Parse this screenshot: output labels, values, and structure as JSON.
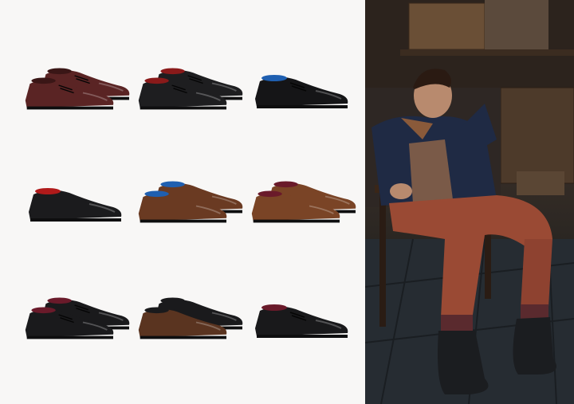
{
  "catalog": {
    "shoes": [
      {
        "id": "oxford-brogue-burgundy",
        "color": "#5a2424",
        "accent": "#3a1616",
        "style": "brogue"
      },
      {
        "id": "oxford-brogue-black",
        "color": "#1e1e20",
        "accent": "#8a1a1a",
        "style": "brogue"
      },
      {
        "id": "oxford-patent-black",
        "color": "#151517",
        "accent": "#1f5fb0",
        "style": "patent"
      },
      {
        "id": "slip-on-black",
        "color": "#1b1b1d",
        "accent": "#b01a1a",
        "style": "slipon"
      },
      {
        "id": "slip-on-brown-pair",
        "color": "#6a3a22",
        "accent": "#1f5fb0",
        "style": "slipon-pair"
      },
      {
        "id": "slip-on-tan-pair",
        "color": "#7a4426",
        "accent": "#6a1a2a",
        "style": "slipon-pair"
      },
      {
        "id": "derby-black-pair",
        "color": "#1a1a1c",
        "accent": "#6a1a2a",
        "style": "derby-pair"
      },
      {
        "id": "slip-on-brown-black-pair",
        "color": "#5a3420",
        "accent": "#1a1a1c",
        "style": "slipon-pair"
      },
      {
        "id": "oxford-black-plain",
        "color": "#19191b",
        "accent": "#6a1a2a",
        "style": "oxford"
      }
    ]
  },
  "photo": {
    "subject": "seated-model",
    "palette": {
      "jacket": "#1f2a44",
      "trousers": "#9a4a34",
      "boots": "#1b1d20",
      "floor": "#2a3036",
      "crates": "#5a4330"
    }
  }
}
